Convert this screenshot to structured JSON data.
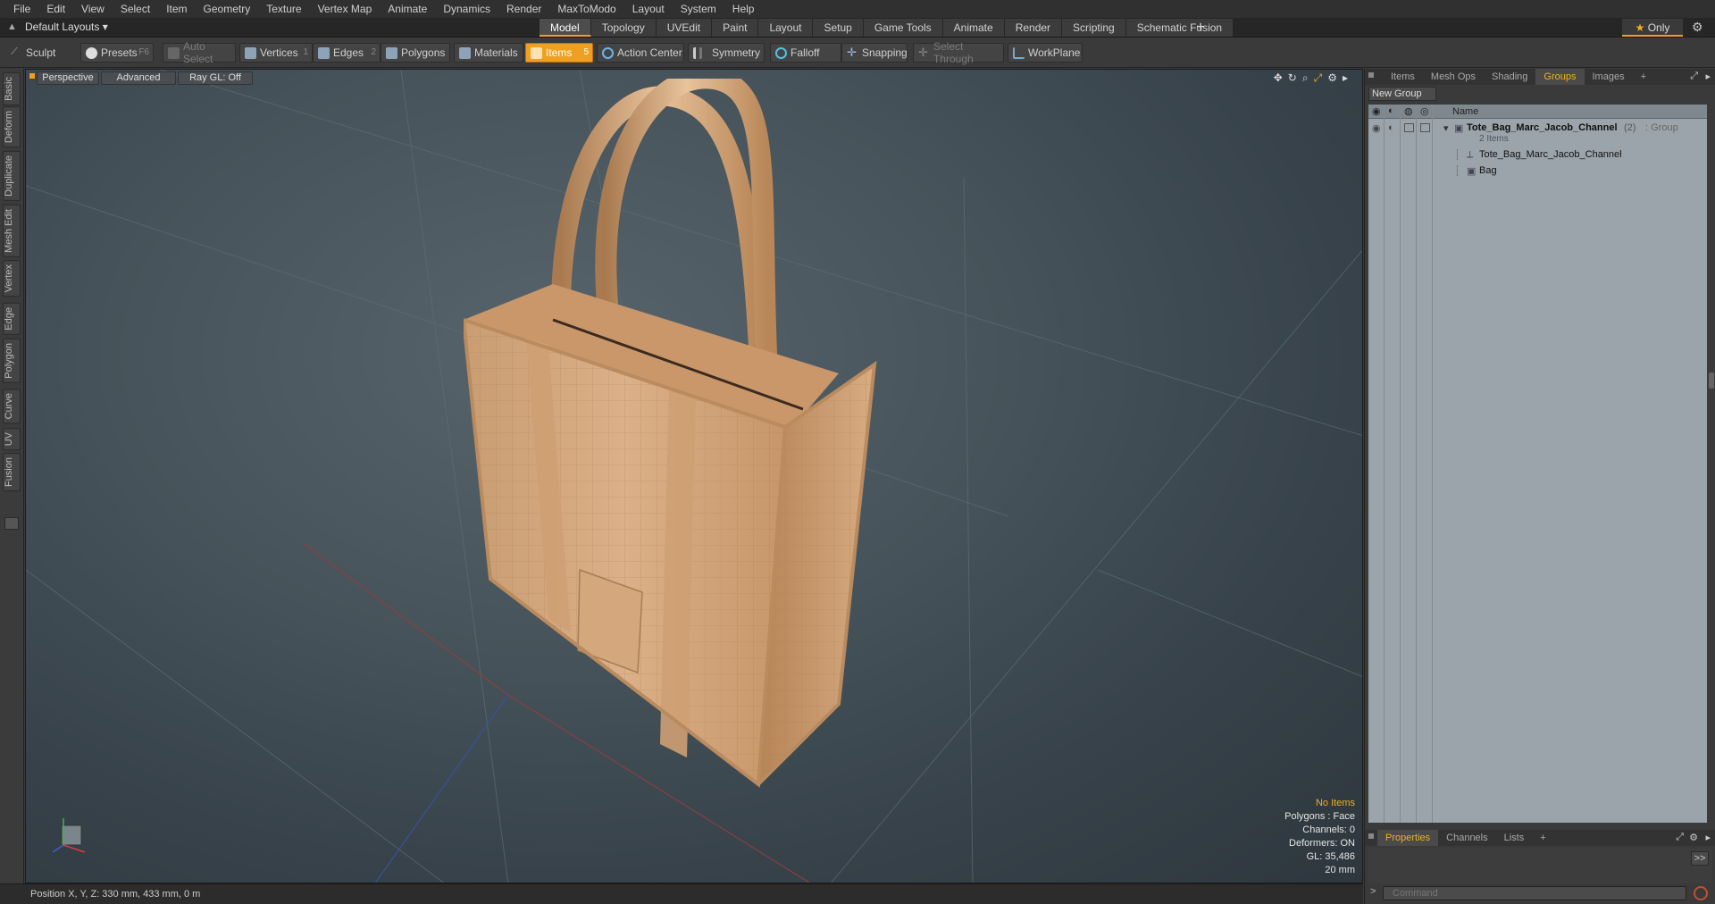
{
  "menu": [
    "File",
    "Edit",
    "View",
    "Select",
    "Item",
    "Geometry",
    "Texture",
    "Vertex Map",
    "Animate",
    "Dynamics",
    "Render",
    "MaxToModo",
    "Layout",
    "System",
    "Help"
  ],
  "layout_select": "Default Layouts ▾",
  "tabs": [
    "Model",
    "Topology",
    "UVEdit",
    "Paint",
    "Layout",
    "Setup",
    "Game Tools",
    "Animate",
    "Render",
    "Scripting",
    "Schematic Fusion"
  ],
  "tab_add": "+",
  "only_label": "Only",
  "toolbar": {
    "sculpt": "Sculpt",
    "presets": "Presets",
    "presets_key": "F6",
    "auto_select": "Auto Select",
    "vertices": "Vertices",
    "vertices_key": "1",
    "edges": "Edges",
    "edges_key": "2",
    "polygons": "Polygons",
    "materials": "Materials",
    "items": "Items",
    "items_key": "5",
    "action_center": "Action Center",
    "symmetry": "Symmetry",
    "falloff": "Falloff",
    "snapping": "Snapping",
    "select_through": "Select Through",
    "workplane": "WorkPlane"
  },
  "side_tabs": [
    "Basic",
    "Deform",
    "Duplicate",
    "Mesh Edit",
    "Vertex",
    "Edge",
    "Polygon",
    "Curve",
    "UV",
    "Fusion"
  ],
  "viewport": {
    "perspective": "Perspective",
    "advanced": "Advanced",
    "raygl": "Ray GL: Off",
    "info": {
      "no_items": "No Items",
      "polygons": "Polygons : Face",
      "channels": "Channels: 0",
      "deformers": "Deformers: ON",
      "gl": "GL: 35,486",
      "scale": "20 mm"
    }
  },
  "status": "Position X, Y, Z:  330 mm, 433 mm, 0 m",
  "right_panel": {
    "tabs": [
      "Items",
      "Mesh Ops",
      "Shading",
      "Groups",
      "Images"
    ],
    "tab_add": "+",
    "new_group": "New Group",
    "name_col": "Name",
    "group_name": "Tote_Bag_Marc_Jacob_Channel",
    "group_count": "(2)",
    "group_type": ": Group",
    "group_sub": "2 Items",
    "child1": "Tote_Bag_Marc_Jacob_Channel",
    "child2": "Bag",
    "bottom_tabs": [
      "Properties",
      "Channels",
      "Lists"
    ],
    "bottom_add": "+",
    "command_placeholder": "Command",
    "expand": ">>"
  },
  "colors": {
    "accent": "#f0a020",
    "viewport_bg": "#46535a",
    "tree_bg": "#9ba4ab",
    "bag": "#d9aa80"
  },
  "icons": [
    "home-icon",
    "gear-icon",
    "star-icon",
    "sphere-icon",
    "cube-icon",
    "move-icon",
    "rotate-icon",
    "zoom-icon",
    "maximize-icon",
    "eye-icon",
    "lock-icon"
  ]
}
